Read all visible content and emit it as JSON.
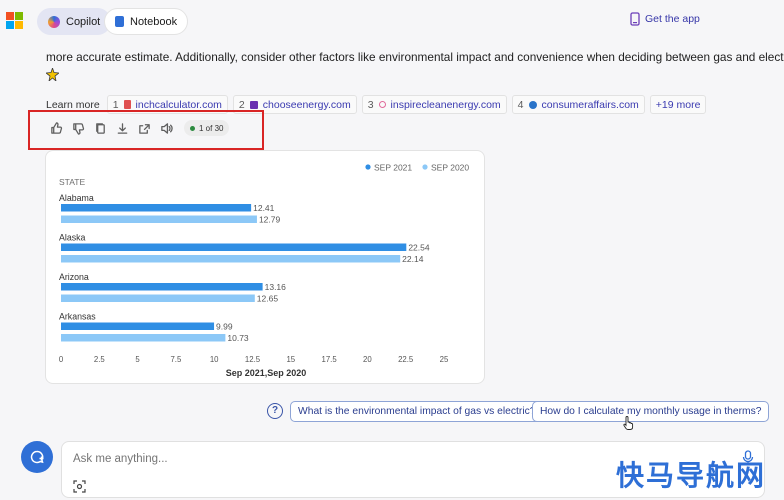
{
  "header": {
    "tabs": [
      {
        "label": "Copilot",
        "icon": "copilot-icon"
      },
      {
        "label": "Notebook",
        "icon": "notebook-icon"
      }
    ],
    "get_app_label": "Get the app"
  },
  "response": {
    "text": "more accurate estimate. Additionally, consider other factors like environmental impact and convenience when deciding between gas and electric.",
    "emoji_icon": "sparkle-icon",
    "learn_more_label": "Learn more",
    "sources": [
      {
        "num": "1",
        "label": "inchcalculator.com"
      },
      {
        "num": "2",
        "label": "chooseenergy.com"
      },
      {
        "num": "3",
        "label": "inspirecleanenergy.com"
      },
      {
        "num": "4",
        "label": "consumeraffairs.com"
      }
    ],
    "more_sources_label": "+19 more",
    "pager_label": "1 of 30"
  },
  "chart_data": {
    "type": "bar",
    "orientation": "horizontal",
    "ylabel": "STATE",
    "xlabel": "Sep 2021,Sep 2020",
    "categories": [
      "Alabama",
      "Alaska",
      "Arizona",
      "Arkansas"
    ],
    "series": [
      {
        "name": "SEP 2021",
        "values": [
          12.41,
          22.54,
          13.16,
          9.99
        ],
        "color": "#2f8ee4"
      },
      {
        "name": "SEP 2020",
        "values": [
          12.79,
          22.14,
          12.65,
          10.73
        ],
        "color": "#8cc8f7"
      }
    ],
    "xlim": [
      0,
      25
    ],
    "xticks": [
      "0",
      "2.5",
      "5",
      "7.5",
      "10",
      "12.5",
      "15",
      "17.5",
      "20",
      "22.5",
      "25"
    ],
    "grid": false,
    "legend_position": "top-right"
  },
  "suggestions": [
    "What is the environmental impact of gas vs electric?",
    "How do I calculate my monthly usage in therms?"
  ],
  "input": {
    "placeholder": "Ask me anything..."
  },
  "watermark": "快马导航网",
  "colors": {
    "accent": "#2f6fd6",
    "highlight": "#d92525"
  }
}
